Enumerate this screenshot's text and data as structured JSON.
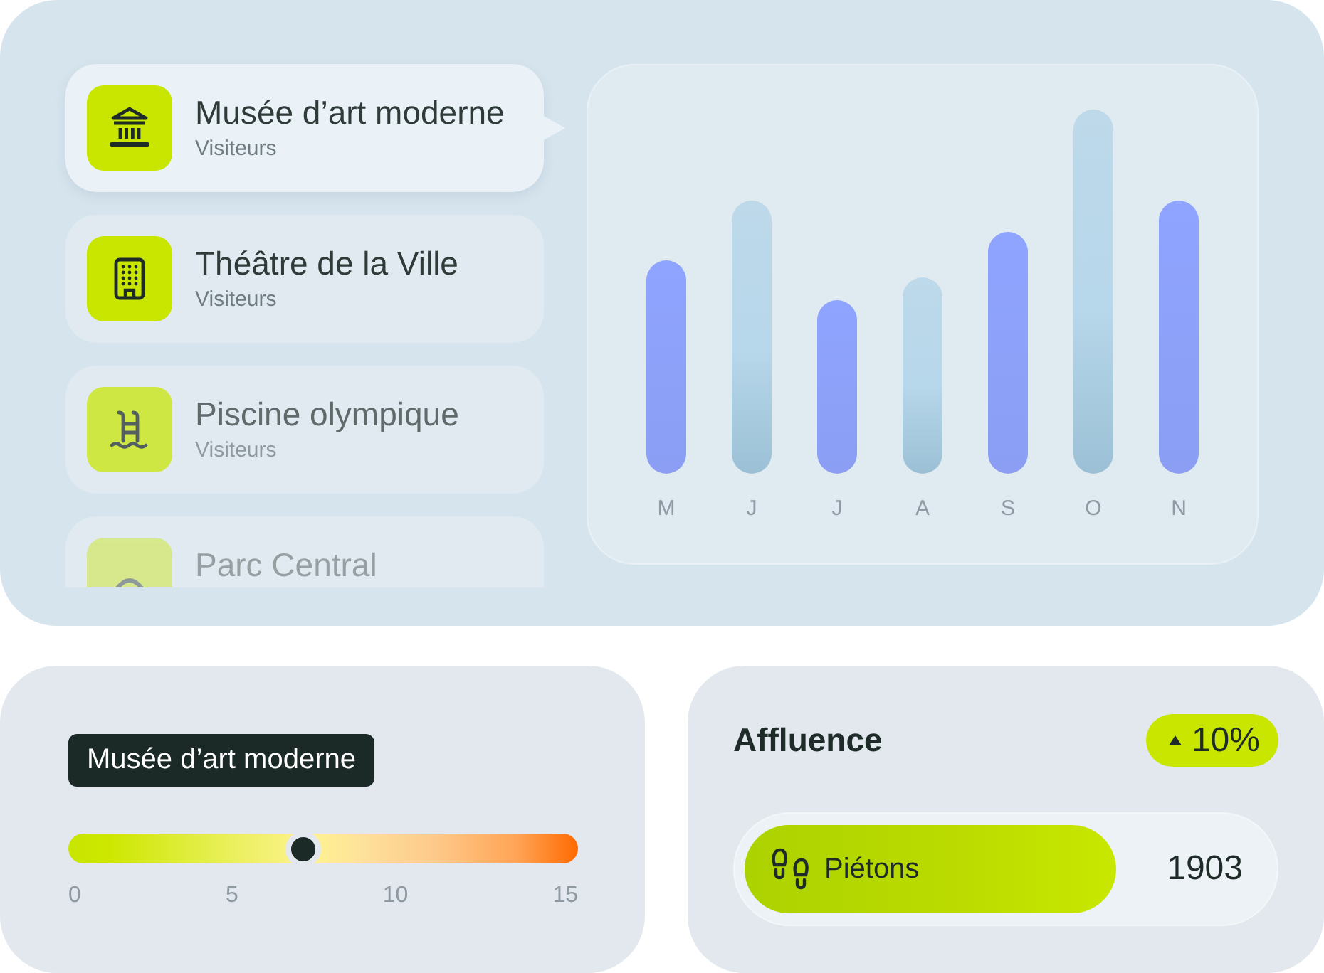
{
  "venues": [
    {
      "name": "Musée d’art moderne",
      "caption": "Visiteurs",
      "kind": "museum",
      "selected": true
    },
    {
      "name": "Théâtre de la Ville",
      "caption": "Visiteurs",
      "kind": "building",
      "selected": false
    },
    {
      "name": "Piscine olympique",
      "caption": "Visiteurs",
      "kind": "pool",
      "selected": false
    },
    {
      "name": "Parc Central",
      "kind": "arc",
      "selected": false
    }
  ],
  "chart": {
    "bars": [
      {
        "label": "M",
        "kind": "primary"
      },
      {
        "label": "J",
        "kind": "secondary"
      },
      {
        "label": "J",
        "kind": "primary"
      },
      {
        "label": "A",
        "kind": "secondary"
      },
      {
        "label": "S",
        "kind": "primary"
      },
      {
        "label": "O",
        "kind": "secondary"
      },
      {
        "label": "N",
        "kind": "primary"
      }
    ]
  },
  "gauge": {
    "tag": "Musée d’art moderne",
    "level": 0.46,
    "ticks": [
      "0",
      "5",
      "10",
      "15"
    ]
  },
  "affluence": {
    "title": "Affluence",
    "change": {
      "value": "10%"
    },
    "category": {
      "label": "Piétons",
      "value": "1903"
    }
  }
}
